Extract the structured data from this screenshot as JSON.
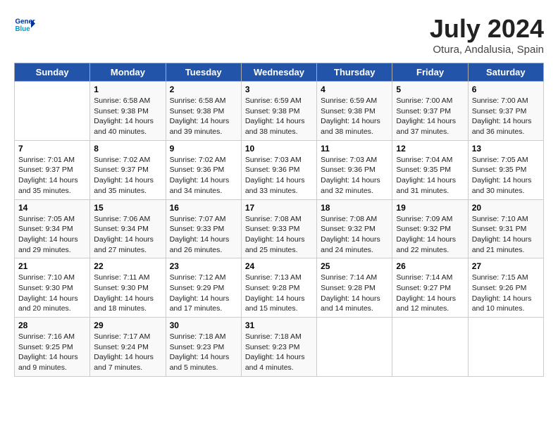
{
  "header": {
    "logo_line1": "General",
    "logo_line2": "Blue",
    "month_title": "July 2024",
    "location": "Otura, Andalusia, Spain"
  },
  "weekdays": [
    "Sunday",
    "Monday",
    "Tuesday",
    "Wednesday",
    "Thursday",
    "Friday",
    "Saturday"
  ],
  "weeks": [
    [
      {
        "day": "",
        "info": ""
      },
      {
        "day": "1",
        "info": "Sunrise: 6:58 AM\nSunset: 9:38 PM\nDaylight: 14 hours\nand 40 minutes."
      },
      {
        "day": "2",
        "info": "Sunrise: 6:58 AM\nSunset: 9:38 PM\nDaylight: 14 hours\nand 39 minutes."
      },
      {
        "day": "3",
        "info": "Sunrise: 6:59 AM\nSunset: 9:38 PM\nDaylight: 14 hours\nand 38 minutes."
      },
      {
        "day": "4",
        "info": "Sunrise: 6:59 AM\nSunset: 9:38 PM\nDaylight: 14 hours\nand 38 minutes."
      },
      {
        "day": "5",
        "info": "Sunrise: 7:00 AM\nSunset: 9:37 PM\nDaylight: 14 hours\nand 37 minutes."
      },
      {
        "day": "6",
        "info": "Sunrise: 7:00 AM\nSunset: 9:37 PM\nDaylight: 14 hours\nand 36 minutes."
      }
    ],
    [
      {
        "day": "7",
        "info": "Sunrise: 7:01 AM\nSunset: 9:37 PM\nDaylight: 14 hours\nand 35 minutes."
      },
      {
        "day": "8",
        "info": "Sunrise: 7:02 AM\nSunset: 9:37 PM\nDaylight: 14 hours\nand 35 minutes."
      },
      {
        "day": "9",
        "info": "Sunrise: 7:02 AM\nSunset: 9:36 PM\nDaylight: 14 hours\nand 34 minutes."
      },
      {
        "day": "10",
        "info": "Sunrise: 7:03 AM\nSunset: 9:36 PM\nDaylight: 14 hours\nand 33 minutes."
      },
      {
        "day": "11",
        "info": "Sunrise: 7:03 AM\nSunset: 9:36 PM\nDaylight: 14 hours\nand 32 minutes."
      },
      {
        "day": "12",
        "info": "Sunrise: 7:04 AM\nSunset: 9:35 PM\nDaylight: 14 hours\nand 31 minutes."
      },
      {
        "day": "13",
        "info": "Sunrise: 7:05 AM\nSunset: 9:35 PM\nDaylight: 14 hours\nand 30 minutes."
      }
    ],
    [
      {
        "day": "14",
        "info": "Sunrise: 7:05 AM\nSunset: 9:34 PM\nDaylight: 14 hours\nand 29 minutes."
      },
      {
        "day": "15",
        "info": "Sunrise: 7:06 AM\nSunset: 9:34 PM\nDaylight: 14 hours\nand 27 minutes."
      },
      {
        "day": "16",
        "info": "Sunrise: 7:07 AM\nSunset: 9:33 PM\nDaylight: 14 hours\nand 26 minutes."
      },
      {
        "day": "17",
        "info": "Sunrise: 7:08 AM\nSunset: 9:33 PM\nDaylight: 14 hours\nand 25 minutes."
      },
      {
        "day": "18",
        "info": "Sunrise: 7:08 AM\nSunset: 9:32 PM\nDaylight: 14 hours\nand 24 minutes."
      },
      {
        "day": "19",
        "info": "Sunrise: 7:09 AM\nSunset: 9:32 PM\nDaylight: 14 hours\nand 22 minutes."
      },
      {
        "day": "20",
        "info": "Sunrise: 7:10 AM\nSunset: 9:31 PM\nDaylight: 14 hours\nand 21 minutes."
      }
    ],
    [
      {
        "day": "21",
        "info": "Sunrise: 7:10 AM\nSunset: 9:30 PM\nDaylight: 14 hours\nand 20 minutes."
      },
      {
        "day": "22",
        "info": "Sunrise: 7:11 AM\nSunset: 9:30 PM\nDaylight: 14 hours\nand 18 minutes."
      },
      {
        "day": "23",
        "info": "Sunrise: 7:12 AM\nSunset: 9:29 PM\nDaylight: 14 hours\nand 17 minutes."
      },
      {
        "day": "24",
        "info": "Sunrise: 7:13 AM\nSunset: 9:28 PM\nDaylight: 14 hours\nand 15 minutes."
      },
      {
        "day": "25",
        "info": "Sunrise: 7:14 AM\nSunset: 9:28 PM\nDaylight: 14 hours\nand 14 minutes."
      },
      {
        "day": "26",
        "info": "Sunrise: 7:14 AM\nSunset: 9:27 PM\nDaylight: 14 hours\nand 12 minutes."
      },
      {
        "day": "27",
        "info": "Sunrise: 7:15 AM\nSunset: 9:26 PM\nDaylight: 14 hours\nand 10 minutes."
      }
    ],
    [
      {
        "day": "28",
        "info": "Sunrise: 7:16 AM\nSunset: 9:25 PM\nDaylight: 14 hours\nand 9 minutes."
      },
      {
        "day": "29",
        "info": "Sunrise: 7:17 AM\nSunset: 9:24 PM\nDaylight: 14 hours\nand 7 minutes."
      },
      {
        "day": "30",
        "info": "Sunrise: 7:18 AM\nSunset: 9:23 PM\nDaylight: 14 hours\nand 5 minutes."
      },
      {
        "day": "31",
        "info": "Sunrise: 7:18 AM\nSunset: 9:23 PM\nDaylight: 14 hours\nand 4 minutes."
      },
      {
        "day": "",
        "info": ""
      },
      {
        "day": "",
        "info": ""
      },
      {
        "day": "",
        "info": ""
      }
    ]
  ]
}
